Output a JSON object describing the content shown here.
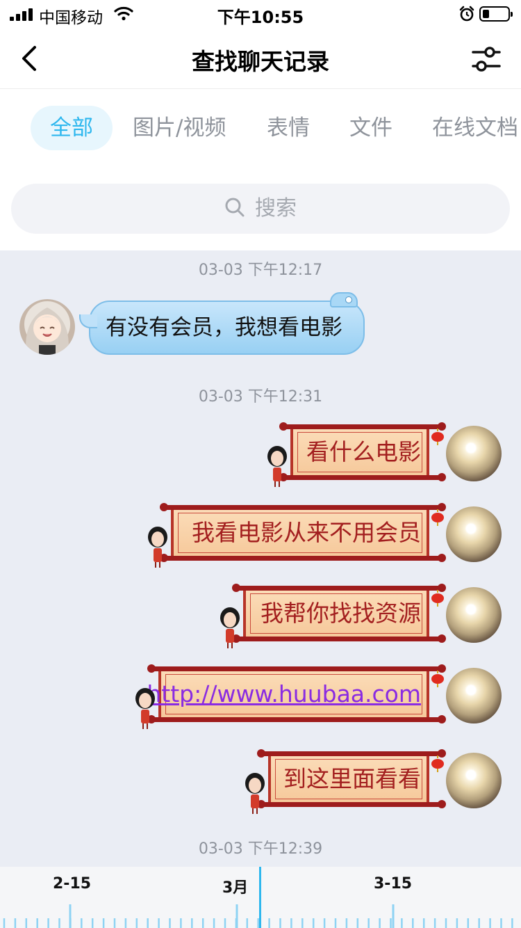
{
  "status_bar": {
    "carrier": "中国移动",
    "time": "下午10:55"
  },
  "navbar": {
    "title": "查找聊天记录"
  },
  "tabs": [
    {
      "label": "全部",
      "active": true
    },
    {
      "label": "图片/视频",
      "active": false
    },
    {
      "label": "表情",
      "active": false
    },
    {
      "label": "文件",
      "active": false
    },
    {
      "label": "在线文档",
      "active": false
    }
  ],
  "search": {
    "placeholder": "搜索"
  },
  "messages": {
    "ts1": "03-03 下午12:17",
    "incoming": "有没有会员，我想看电影",
    "ts2": "03-03 下午12:31",
    "outgoing": [
      "看什么电影",
      "我看电影从来不用会员",
      "我帮你找找资源",
      "http://www.huubaa.com",
      "到这里面看看"
    ],
    "ts3": "03-03 下午12:39"
  },
  "timeline": {
    "labels": [
      "2-15",
      "3月",
      "3-15"
    ]
  },
  "colors": {
    "accent": "#2eb7ee",
    "scroll_text": "#a31f1f",
    "link": "#8a2be2"
  }
}
